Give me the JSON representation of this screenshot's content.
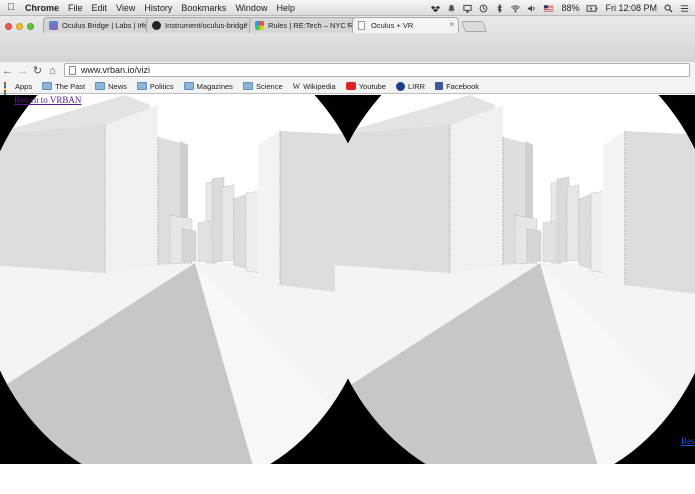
{
  "menubar": {
    "app_name": "Chrome",
    "items": [
      "File",
      "Edit",
      "View",
      "History",
      "Bookmarks",
      "Window",
      "Help"
    ],
    "battery": "88%",
    "clock": "Fri 12:08 PM"
  },
  "tabs": [
    {
      "title": "Oculus Bridge | Labs | Inst",
      "active": false
    },
    {
      "title": "Instrument/oculus-bridge",
      "active": false
    },
    {
      "title": "Rules | RE:Tech – NYC Rea",
      "active": false
    },
    {
      "title": "Oculus + VR",
      "active": true
    }
  ],
  "toolbar": {
    "url": "www.vrban.io/vizi"
  },
  "bookmarks": [
    "Apps",
    "The Past",
    "News",
    "Politics",
    "Magazines",
    "Science",
    "Wikipedia",
    "Youtube",
    "LIRR",
    "Facebook"
  ],
  "page": {
    "return_link": "Return to VRBAN",
    "right_link": "Reset"
  },
  "colors": {
    "building_light": "#f2f2f2",
    "building_mid": "#e2e2e2",
    "building_dark": "#cfcfcf",
    "ground_shadow": "#c6c6c6",
    "link": "#551a8b"
  }
}
